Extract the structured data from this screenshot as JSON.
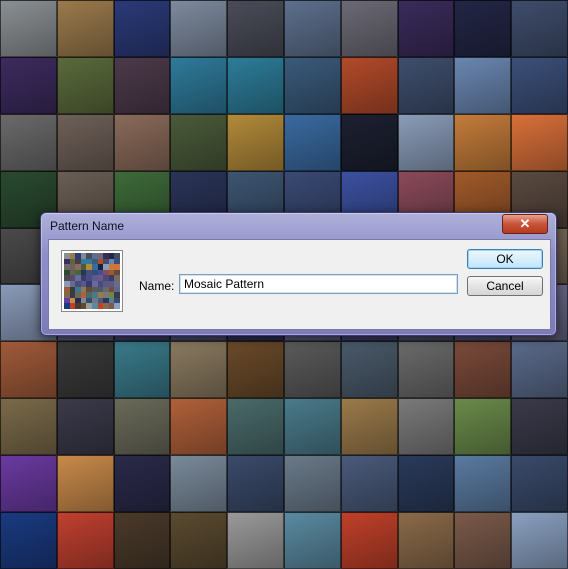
{
  "dialog": {
    "title": "Pattern Name",
    "close_glyph": "✕",
    "name_label": "Name:",
    "name_value": "Mosaic Pattern",
    "ok_label": "OK",
    "cancel_label": "Cancel",
    "thumbnail_icon": "mosaic-thumbnail"
  },
  "background": {
    "description_icon": "photo-mosaic",
    "tile_colors": [
      "#8a8f93",
      "#9a7a4c",
      "#2b3a78",
      "#7d8a9e",
      "#4a4c58",
      "#5d6f8c",
      "#6b6a75",
      "#3a2b5a",
      "#232645",
      "#3f4d6b",
      "#3c2b5e",
      "#5a6a3c",
      "#4c3a4a",
      "#2f7a9a",
      "#2d7c98",
      "#3a5a7a",
      "#b24a2a",
      "#3e4e6c",
      "#6a86b0",
      "#3c4f78",
      "#6a6a6a",
      "#6e6058",
      "#8a6a5a",
      "#4a5a3a",
      "#b28a3a",
      "#3a6aa0",
      "#1c2030",
      "#8a9cb8",
      "#c47c3a",
      "#d8703a",
      "#2a4a30",
      "#6a5e54",
      "#3e6a3a",
      "#2a3458",
      "#3d5572",
      "#3a4a74",
      "#3c50a0",
      "#8a4a5a",
      "#a05a2a",
      "#5a4a40",
      "#4a4a4a",
      "#5a4a6a",
      "#6a6aa0",
      "#3a3c6a",
      "#4c4a84",
      "#5a5a90",
      "#6a5a8a",
      "#4a4a7a",
      "#3a3a6a",
      "#7a6a5a",
      "#8a9ab8",
      "#6a6a90",
      "#4a4c7a",
      "#5a5a8a",
      "#3a3a70",
      "#6a6a9a",
      "#4a4a80",
      "#5a5a80",
      "#5a5a88",
      "#6a6a8a",
      "#a05a3a",
      "#3a3a3a",
      "#3a7a8a",
      "#8a7a60",
      "#6a4a2a",
      "#5a5a5a",
      "#4a5a6a",
      "#6a6a6a",
      "#7a4a3a",
      "#5a6a8a",
      "#7a6a4a",
      "#3a3a4a",
      "#6a6a5a",
      "#b0603a",
      "#4a6a6a",
      "#4a7a8a",
      "#9a7a4a",
      "#7a7a7a",
      "#6a8a4a",
      "#3a3a4a",
      "#6a3aa0",
      "#c88a4a",
      "#2a2a4a",
      "#7a8a9a",
      "#3a4a6a",
      "#6a7a8a",
      "#4a5a7a",
      "#2a3a5a",
      "#5a7aa0",
      "#3a4a6a",
      "#1a3a80",
      "#c04030",
      "#4a3a2a",
      "#5a4a30",
      "#9a9a9a",
      "#5a8aa0",
      "#c0402a",
      "#8a6a4a",
      "#7a5a4a",
      "#8aa0c0"
    ]
  }
}
